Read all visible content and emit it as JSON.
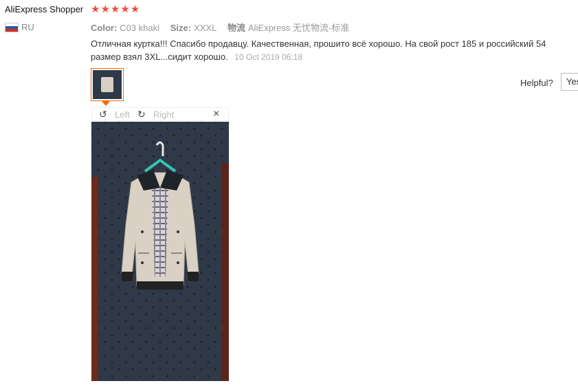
{
  "review": {
    "user_name": "AliExpress Shopper",
    "stars": "★★★★★",
    "country": "RU",
    "color_label": "Color:",
    "color_value": "C03 khaki",
    "size_label": "Size:",
    "size_value": "XXXL",
    "shipping_label": "物流",
    "shipping_value": "AliExpress 无忧物流-标准",
    "text": "Отличная куртка!!! Спасибо продавцу. Качественная, прошито всё хорошо. На свой рост 185 и российский 54 размер взял 3XL...сидит хорошо.",
    "date": "10 Oct 2019 06:18"
  },
  "helpful": {
    "label": "Helpful?",
    "yes_label": "Yes"
  },
  "viewer": {
    "left_label": "Left",
    "right_label": "Right",
    "close_label": "×",
    "rotate_left_icon": "↺",
    "rotate_right_icon": "↻"
  },
  "colors": {
    "accent": "#ff6600",
    "star": "#f44b39"
  }
}
